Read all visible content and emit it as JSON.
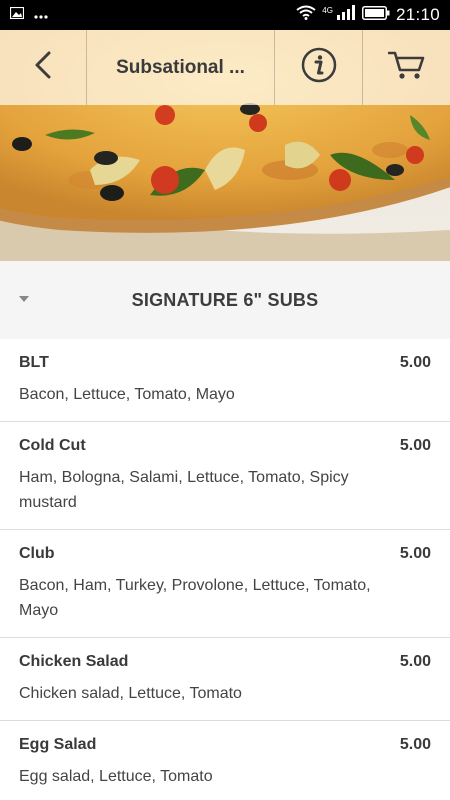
{
  "status_bar": {
    "time": "21:10",
    "network": "4G",
    "icons": [
      "image-icon",
      "more-icon",
      "wifi-icon",
      "signal-icon",
      "battery-icon"
    ]
  },
  "header": {
    "title": "Subsational ...",
    "icons": [
      "back-arrow-icon",
      "info-icon",
      "cart-icon"
    ]
  },
  "section": {
    "title": "SIGNATURE 6\" SUBS",
    "icon": "caret-down-icon"
  },
  "items": [
    {
      "name": "BLT",
      "price": "5.00",
      "description": "Bacon, Lettuce, Tomato, Mayo"
    },
    {
      "name": "Cold Cut",
      "price": "5.00",
      "description": "Ham, Bologna, Salami, Lettuce, Tomato, Spicy mustard"
    },
    {
      "name": "Club",
      "price": "5.00",
      "description": "Bacon, Ham, Turkey, Provolone, Lettuce, Tomato, Mayo"
    },
    {
      "name": "Chicken Salad",
      "price": "5.00",
      "description": "Chicken salad, Lettuce, Tomato"
    },
    {
      "name": "Egg Salad",
      "price": "5.00",
      "description": "Egg salad, Lettuce, Tomato"
    }
  ]
}
